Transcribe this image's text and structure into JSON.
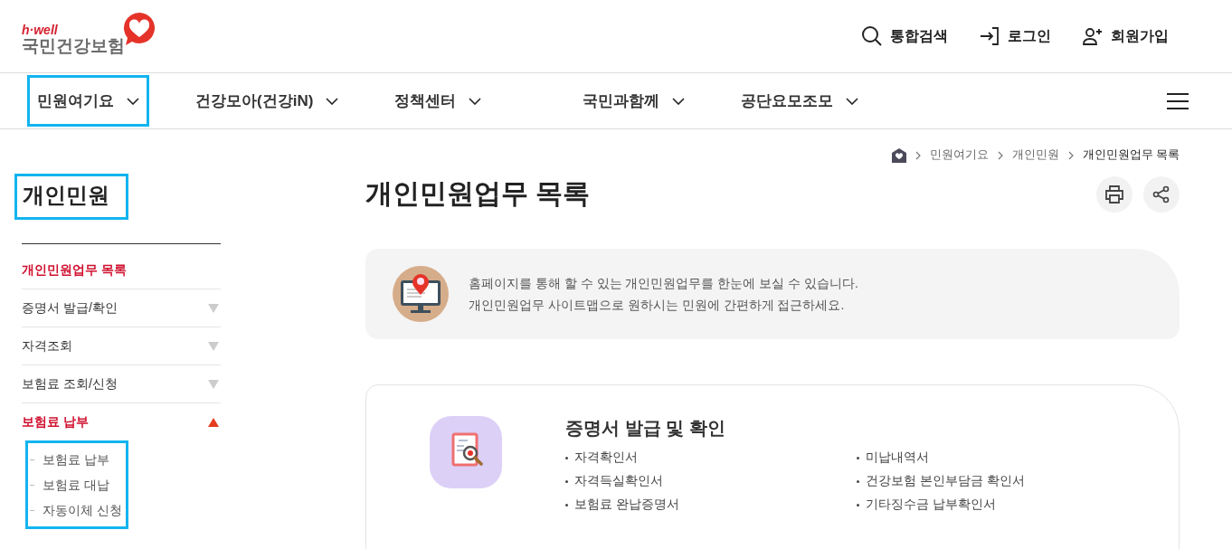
{
  "logo": {
    "tagline": "h·well",
    "name": "국민건강보험"
  },
  "utility_links": [
    {
      "kind": "search",
      "label": "통합검색"
    },
    {
      "kind": "login",
      "label": "로그인"
    },
    {
      "kind": "signup",
      "label": "회원가입"
    }
  ],
  "nav": {
    "items": [
      {
        "label": "민원여기요",
        "highlighted": true
      },
      {
        "label": "건강모아(건강iN)",
        "highlighted": false
      },
      {
        "label": "정책센터",
        "highlighted": false
      },
      {
        "label": "국민과함께",
        "highlighted": false
      },
      {
        "label": "공단요모조모",
        "highlighted": false
      }
    ]
  },
  "breadcrumb": [
    "민원여기요",
    "개인민원",
    "개인민원업무 목록"
  ],
  "sidebar": {
    "title": "개인민원",
    "title_highlighted": true,
    "items": [
      {
        "label": "개인민원업무 목록",
        "selected": true,
        "expandable": false,
        "expanded": false
      },
      {
        "label": "증명서 발급/확인",
        "selected": false,
        "expandable": true,
        "expanded": false
      },
      {
        "label": "자격조회",
        "selected": false,
        "expandable": true,
        "expanded": false
      },
      {
        "label": "보험료 조회/신청",
        "selected": false,
        "expandable": true,
        "expanded": false
      },
      {
        "label": "보험료 납부",
        "selected": true,
        "expandable": true,
        "expanded": true,
        "children_highlighted": true,
        "children": [
          {
            "label": "보험료 납부"
          },
          {
            "label": "보험료 대납"
          },
          {
            "label": "자동이체 신청"
          }
        ]
      }
    ]
  },
  "page_title": "개인민원업무 목록",
  "info": {
    "lines": [
      "홈페이지를 통해 할 수 있는 개인민원업무를 한눈에 보실 수 있습니다.",
      "개인민원업무 사이트맵으로 원하시는 민원에 간편하게 접근하세요."
    ]
  },
  "sections": [
    {
      "title": "증명서 발급 및 확인",
      "links": [
        "자격확인서",
        "미납내역서",
        "자격득실확인서",
        "건강보험 본인부담금 확인서",
        "보험료 완납증명서",
        "기타징수금 납부확인서"
      ]
    }
  ]
}
